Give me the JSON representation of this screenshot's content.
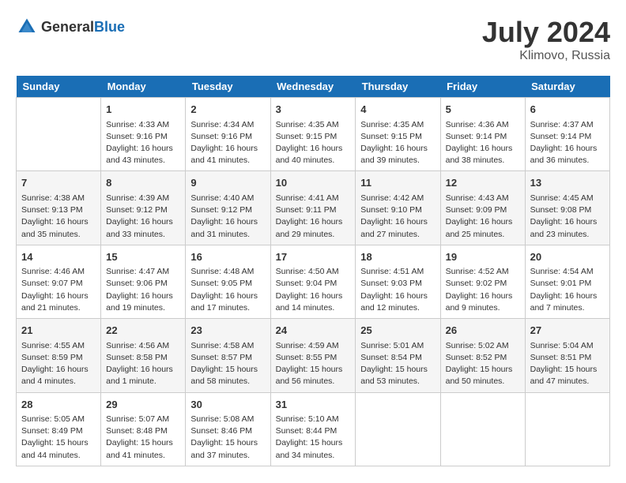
{
  "header": {
    "logo_general": "General",
    "logo_blue": "Blue",
    "title": "July 2024",
    "location": "Klimovo, Russia"
  },
  "days_of_week": [
    "Sunday",
    "Monday",
    "Tuesday",
    "Wednesday",
    "Thursday",
    "Friday",
    "Saturday"
  ],
  "weeks": [
    [
      {
        "day": "",
        "empty": true
      },
      {
        "day": "1",
        "sunrise": "Sunrise: 4:33 AM",
        "sunset": "Sunset: 9:16 PM",
        "daylight": "Daylight: 16 hours and 43 minutes."
      },
      {
        "day": "2",
        "sunrise": "Sunrise: 4:34 AM",
        "sunset": "Sunset: 9:16 PM",
        "daylight": "Daylight: 16 hours and 41 minutes."
      },
      {
        "day": "3",
        "sunrise": "Sunrise: 4:35 AM",
        "sunset": "Sunset: 9:15 PM",
        "daylight": "Daylight: 16 hours and 40 minutes."
      },
      {
        "day": "4",
        "sunrise": "Sunrise: 4:35 AM",
        "sunset": "Sunset: 9:15 PM",
        "daylight": "Daylight: 16 hours and 39 minutes."
      },
      {
        "day": "5",
        "sunrise": "Sunrise: 4:36 AM",
        "sunset": "Sunset: 9:14 PM",
        "daylight": "Daylight: 16 hours and 38 minutes."
      },
      {
        "day": "6",
        "sunrise": "Sunrise: 4:37 AM",
        "sunset": "Sunset: 9:14 PM",
        "daylight": "Daylight: 16 hours and 36 minutes."
      }
    ],
    [
      {
        "day": "7",
        "sunrise": "Sunrise: 4:38 AM",
        "sunset": "Sunset: 9:13 PM",
        "daylight": "Daylight: 16 hours and 35 minutes."
      },
      {
        "day": "8",
        "sunrise": "Sunrise: 4:39 AM",
        "sunset": "Sunset: 9:12 PM",
        "daylight": "Daylight: 16 hours and 33 minutes."
      },
      {
        "day": "9",
        "sunrise": "Sunrise: 4:40 AM",
        "sunset": "Sunset: 9:12 PM",
        "daylight": "Daylight: 16 hours and 31 minutes."
      },
      {
        "day": "10",
        "sunrise": "Sunrise: 4:41 AM",
        "sunset": "Sunset: 9:11 PM",
        "daylight": "Daylight: 16 hours and 29 minutes."
      },
      {
        "day": "11",
        "sunrise": "Sunrise: 4:42 AM",
        "sunset": "Sunset: 9:10 PM",
        "daylight": "Daylight: 16 hours and 27 minutes."
      },
      {
        "day": "12",
        "sunrise": "Sunrise: 4:43 AM",
        "sunset": "Sunset: 9:09 PM",
        "daylight": "Daylight: 16 hours and 25 minutes."
      },
      {
        "day": "13",
        "sunrise": "Sunrise: 4:45 AM",
        "sunset": "Sunset: 9:08 PM",
        "daylight": "Daylight: 16 hours and 23 minutes."
      }
    ],
    [
      {
        "day": "14",
        "sunrise": "Sunrise: 4:46 AM",
        "sunset": "Sunset: 9:07 PM",
        "daylight": "Daylight: 16 hours and 21 minutes."
      },
      {
        "day": "15",
        "sunrise": "Sunrise: 4:47 AM",
        "sunset": "Sunset: 9:06 PM",
        "daylight": "Daylight: 16 hours and 19 minutes."
      },
      {
        "day": "16",
        "sunrise": "Sunrise: 4:48 AM",
        "sunset": "Sunset: 9:05 PM",
        "daylight": "Daylight: 16 hours and 17 minutes."
      },
      {
        "day": "17",
        "sunrise": "Sunrise: 4:50 AM",
        "sunset": "Sunset: 9:04 PM",
        "daylight": "Daylight: 16 hours and 14 minutes."
      },
      {
        "day": "18",
        "sunrise": "Sunrise: 4:51 AM",
        "sunset": "Sunset: 9:03 PM",
        "daylight": "Daylight: 16 hours and 12 minutes."
      },
      {
        "day": "19",
        "sunrise": "Sunrise: 4:52 AM",
        "sunset": "Sunset: 9:02 PM",
        "daylight": "Daylight: 16 hours and 9 minutes."
      },
      {
        "day": "20",
        "sunrise": "Sunrise: 4:54 AM",
        "sunset": "Sunset: 9:01 PM",
        "daylight": "Daylight: 16 hours and 7 minutes."
      }
    ],
    [
      {
        "day": "21",
        "sunrise": "Sunrise: 4:55 AM",
        "sunset": "Sunset: 8:59 PM",
        "daylight": "Daylight: 16 hours and 4 minutes."
      },
      {
        "day": "22",
        "sunrise": "Sunrise: 4:56 AM",
        "sunset": "Sunset: 8:58 PM",
        "daylight": "Daylight: 16 hours and 1 minute."
      },
      {
        "day": "23",
        "sunrise": "Sunrise: 4:58 AM",
        "sunset": "Sunset: 8:57 PM",
        "daylight": "Daylight: 15 hours and 58 minutes."
      },
      {
        "day": "24",
        "sunrise": "Sunrise: 4:59 AM",
        "sunset": "Sunset: 8:55 PM",
        "daylight": "Daylight: 15 hours and 56 minutes."
      },
      {
        "day": "25",
        "sunrise": "Sunrise: 5:01 AM",
        "sunset": "Sunset: 8:54 PM",
        "daylight": "Daylight: 15 hours and 53 minutes."
      },
      {
        "day": "26",
        "sunrise": "Sunrise: 5:02 AM",
        "sunset": "Sunset: 8:52 PM",
        "daylight": "Daylight: 15 hours and 50 minutes."
      },
      {
        "day": "27",
        "sunrise": "Sunrise: 5:04 AM",
        "sunset": "Sunset: 8:51 PM",
        "daylight": "Daylight: 15 hours and 47 minutes."
      }
    ],
    [
      {
        "day": "28",
        "sunrise": "Sunrise: 5:05 AM",
        "sunset": "Sunset: 8:49 PM",
        "daylight": "Daylight: 15 hours and 44 minutes."
      },
      {
        "day": "29",
        "sunrise": "Sunrise: 5:07 AM",
        "sunset": "Sunset: 8:48 PM",
        "daylight": "Daylight: 15 hours and 41 minutes."
      },
      {
        "day": "30",
        "sunrise": "Sunrise: 5:08 AM",
        "sunset": "Sunset: 8:46 PM",
        "daylight": "Daylight: 15 hours and 37 minutes."
      },
      {
        "day": "31",
        "sunrise": "Sunrise: 5:10 AM",
        "sunset": "Sunset: 8:44 PM",
        "daylight": "Daylight: 15 hours and 34 minutes."
      },
      {
        "day": "",
        "empty": true
      },
      {
        "day": "",
        "empty": true
      },
      {
        "day": "",
        "empty": true
      }
    ]
  ]
}
